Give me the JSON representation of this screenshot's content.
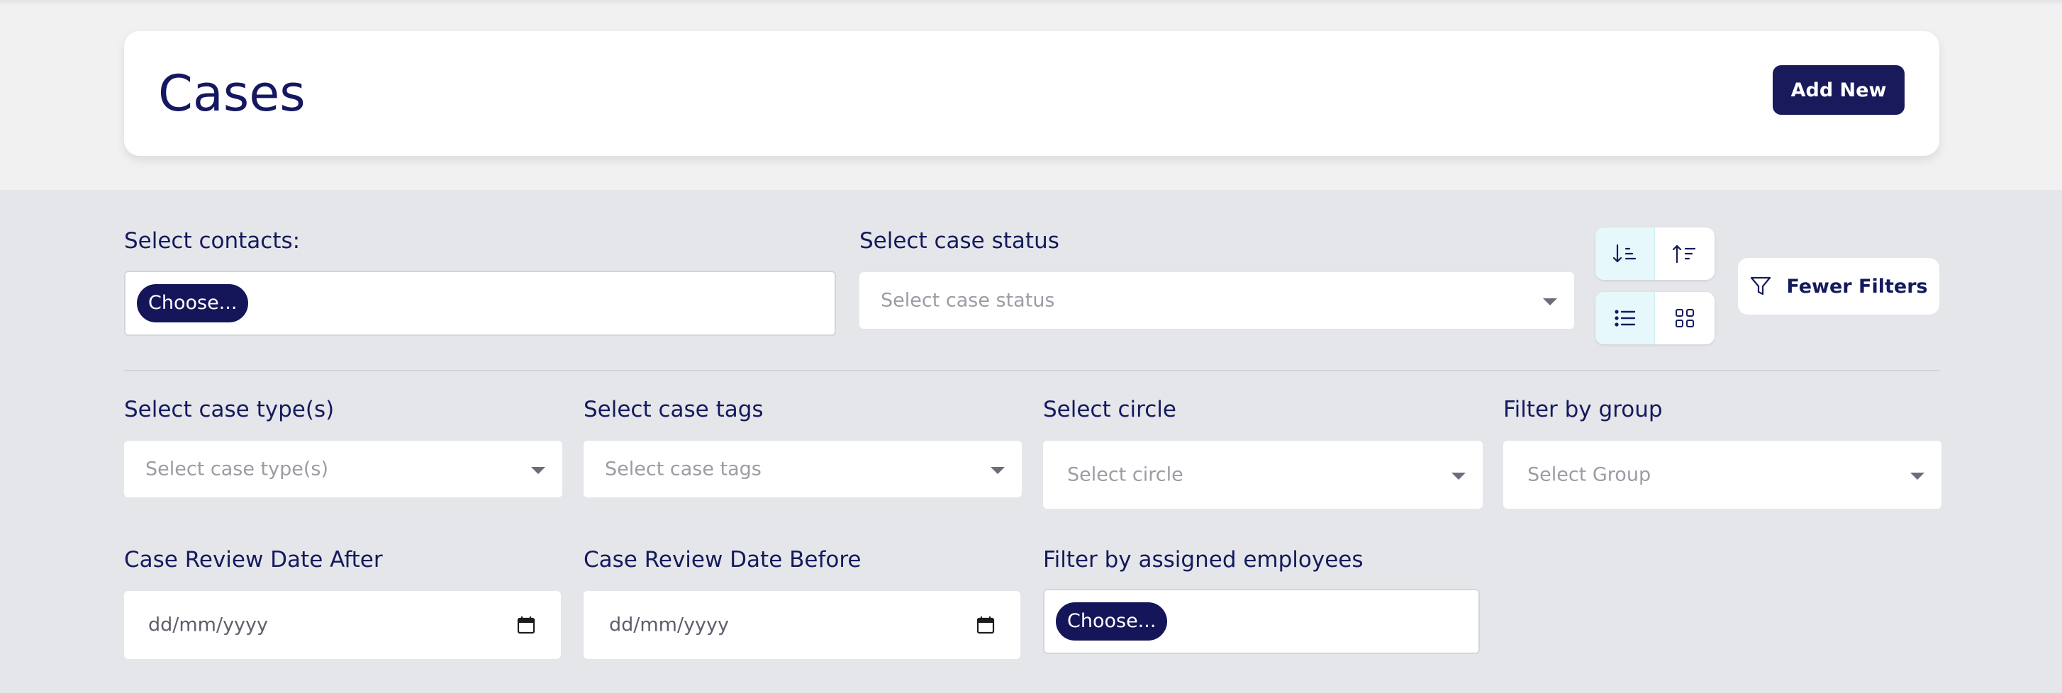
{
  "header": {
    "title": "Cases",
    "add_button_label": "Add New"
  },
  "filters": {
    "contacts": {
      "label": "Select contacts:",
      "chip": "Choose..."
    },
    "case_status": {
      "label": "Select case status",
      "placeholder": "Select case status"
    },
    "case_types": {
      "label": "Select case type(s)",
      "placeholder": "Select case type(s)"
    },
    "case_tags": {
      "label": "Select case tags",
      "placeholder": "Select case tags"
    },
    "circle": {
      "label": "Select circle",
      "placeholder": "Select circle"
    },
    "group": {
      "label": "Filter by group",
      "placeholder": "Select Group"
    },
    "review_after": {
      "label": "Case Review Date After",
      "placeholder": "dd/mm/yyyy"
    },
    "review_before": {
      "label": "Case Review Date Before",
      "placeholder": "dd/mm/yyyy"
    },
    "employees": {
      "label": "Filter by assigned employees",
      "chip": "Choose..."
    },
    "toggle_button_label": "Fewer Filters"
  },
  "icons": {
    "sort_ascending": "sort-ascending-icon",
    "sort_descending": "sort-descending-icon",
    "list_view": "list-view-icon",
    "grid_view": "grid-view-icon",
    "filter": "filter-icon",
    "calendar": "calendar-icon"
  },
  "colors": {
    "primary": "#191a5c",
    "page_background": "#e5e6ea",
    "active_toggle": "#e6f8fc"
  }
}
